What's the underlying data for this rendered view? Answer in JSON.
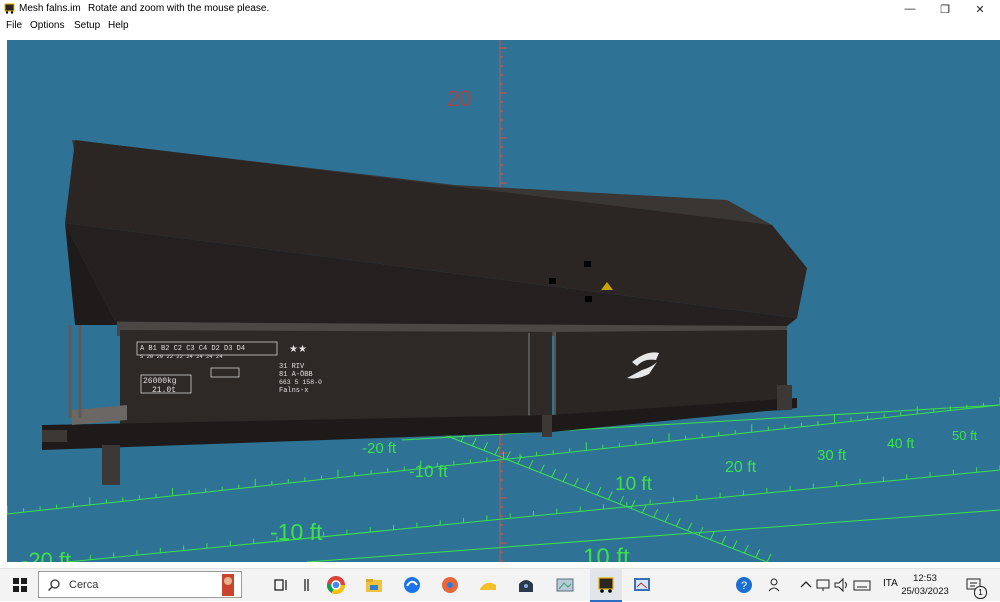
{
  "window": {
    "title": "Mesh falns.im",
    "status_message": "Rotate and zoom with the mouse please."
  },
  "menu": {
    "items": [
      "File",
      "Options",
      "Setup",
      "Help"
    ]
  },
  "scene": {
    "background_color": "#2e7395",
    "vertical_axis_color": "#b55858",
    "floor_grid_color": "#3de04a",
    "vertical_axis_label": "20",
    "floor_labels": [
      "-20 ft",
      "-10 ft",
      "20 ft",
      "30 ft",
      "40 ft",
      "50 ft",
      "10 ft",
      "-10 ft",
      "10 ft",
      "-20 ft"
    ],
    "wagon": {
      "body_color": "#2b2624",
      "markings_left": {
        "grid_head": "A  B1 B2 C2 C3 C4 D2 D3 D4",
        "grid_vals": "S  20  20  22  22  24  24  24  24",
        "weight": "26000kg",
        "tonnes": "21.0t",
        "line1": "31 RIV",
        "line2": "81 A-ÖBB",
        "line3": "663 5 158-0",
        "line4": "Falns-x"
      },
      "logo_text": "S"
    }
  },
  "taskbar": {
    "search_placeholder": "Cerca",
    "language": "ITA",
    "time": "12:53",
    "date": "25/03/2023",
    "notification_count": "1",
    "icons": [
      "windows-start-icon",
      "search-icon",
      "task-view-icon",
      "chrome-icon",
      "file-explorer-icon",
      "app-icon",
      "app-icon",
      "app-icon",
      "app-icon",
      "app-icon",
      "train-app-icon",
      "app-icon",
      "help-icon",
      "people-icon",
      "chevron-up-icon",
      "network-icon",
      "volume-icon",
      "keyboard-icon",
      "notification-icon"
    ]
  }
}
